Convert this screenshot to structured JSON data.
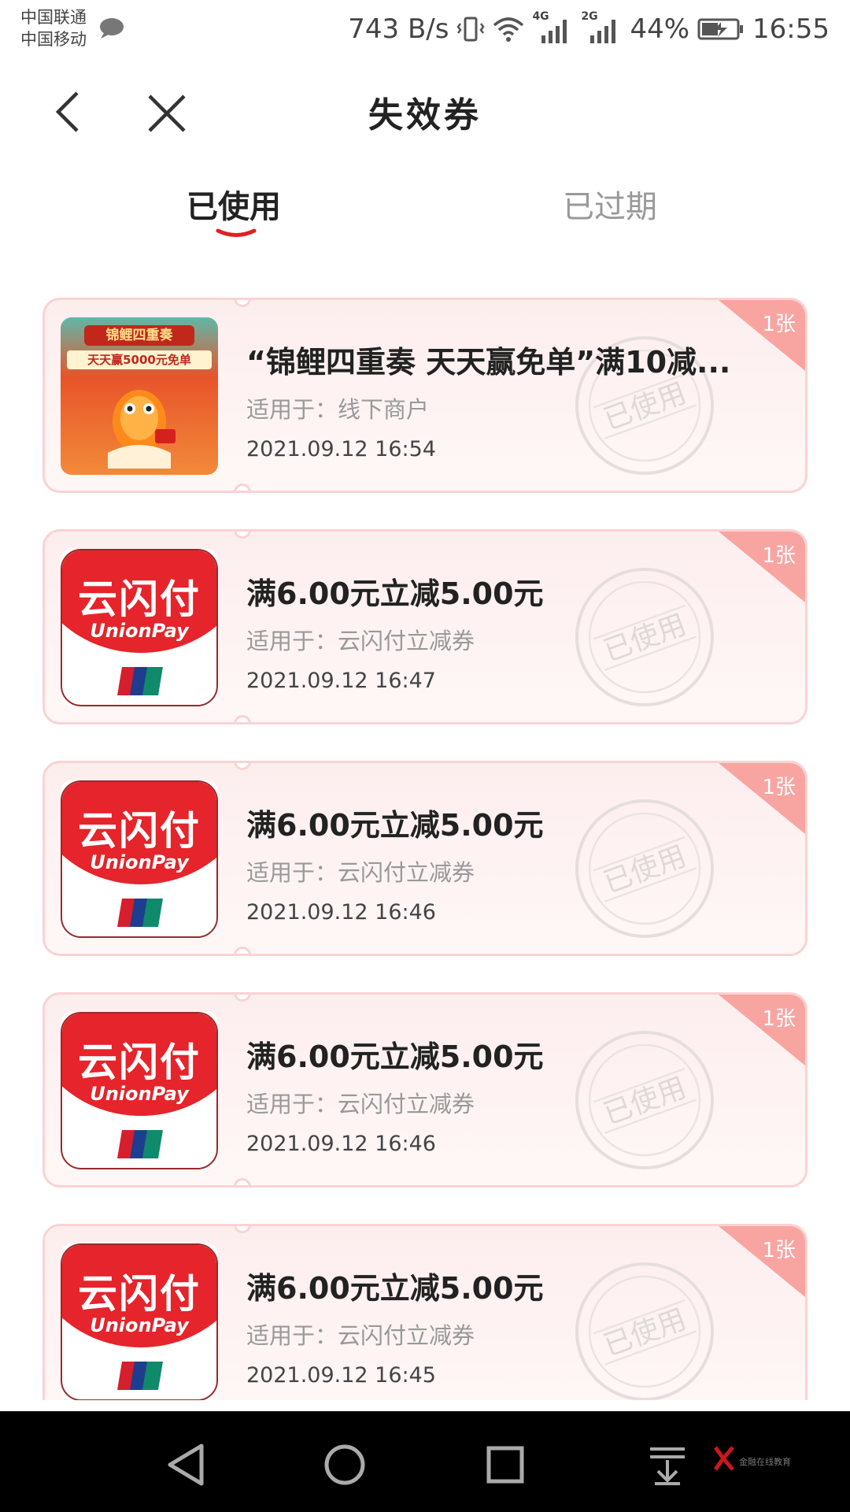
{
  "status_bar": {
    "carrier_1": "中国联通",
    "carrier_2": "中国移动",
    "speed": "743 B/s",
    "net_4g": "4G",
    "net_2g": "2G",
    "battery": "44%",
    "time": "16:55"
  },
  "nav": {
    "title": "失效券",
    "back_icon": "chevron-left-icon",
    "close_icon": "close-icon"
  },
  "tabs": {
    "items": [
      {
        "label": "已使用",
        "active": true
      },
      {
        "label": "已过期",
        "active": false
      }
    ],
    "accent_color": "#e02020"
  },
  "coupons": [
    {
      "title": "“锦鲤四重奏 天天赢免单”满10减...",
      "scope_prefix": "适用于：",
      "scope": "线下商户",
      "date": "2021.09.12 16:54",
      "count": "1张",
      "stamp": "已使用",
      "thumb": "koi-promo",
      "thumb_banner": "锦鲤四重奏",
      "thumb_subtitle": "天天赢5000元免单"
    },
    {
      "title": "满6.00元立减5.00元",
      "scope_prefix": "适用于：",
      "scope": "云闪付立减券",
      "date": "2021.09.12 16:47",
      "count": "1张",
      "stamp": "已使用",
      "thumb": "unionpay-logo",
      "logo_cn": "云闪付",
      "logo_en": "UnionPay"
    },
    {
      "title": "满6.00元立减5.00元",
      "scope_prefix": "适用于：",
      "scope": "云闪付立减券",
      "date": "2021.09.12 16:46",
      "count": "1张",
      "stamp": "已使用",
      "thumb": "unionpay-logo",
      "logo_cn": "云闪付",
      "logo_en": "UnionPay"
    },
    {
      "title": "满6.00元立减5.00元",
      "scope_prefix": "适用于：",
      "scope": "云闪付立减券",
      "date": "2021.09.12 16:46",
      "count": "1张",
      "stamp": "已使用",
      "thumb": "unionpay-logo",
      "logo_cn": "云闪付",
      "logo_en": "UnionPay"
    },
    {
      "title": "满6.00元立减5.00元",
      "scope_prefix": "适用于：",
      "scope": "云闪付立减券",
      "date": "2021.09.12 16:45",
      "count": "1张",
      "stamp": "已使用",
      "thumb": "unionpay-logo",
      "logo_cn": "云闪付",
      "logo_en": "UnionPay"
    }
  ],
  "system_nav": {
    "back_icon": "triangle-back-icon",
    "home_icon": "circle-home-icon",
    "recents_icon": "square-recents-icon",
    "notification_icon": "pull-down-icon",
    "watermark_text": "金融在线教育"
  },
  "colors": {
    "card_border": "#fbd2d2",
    "card_bg": "#fdeeee",
    "badge": "#f8a5a2",
    "brand_red": "#e5242b"
  }
}
